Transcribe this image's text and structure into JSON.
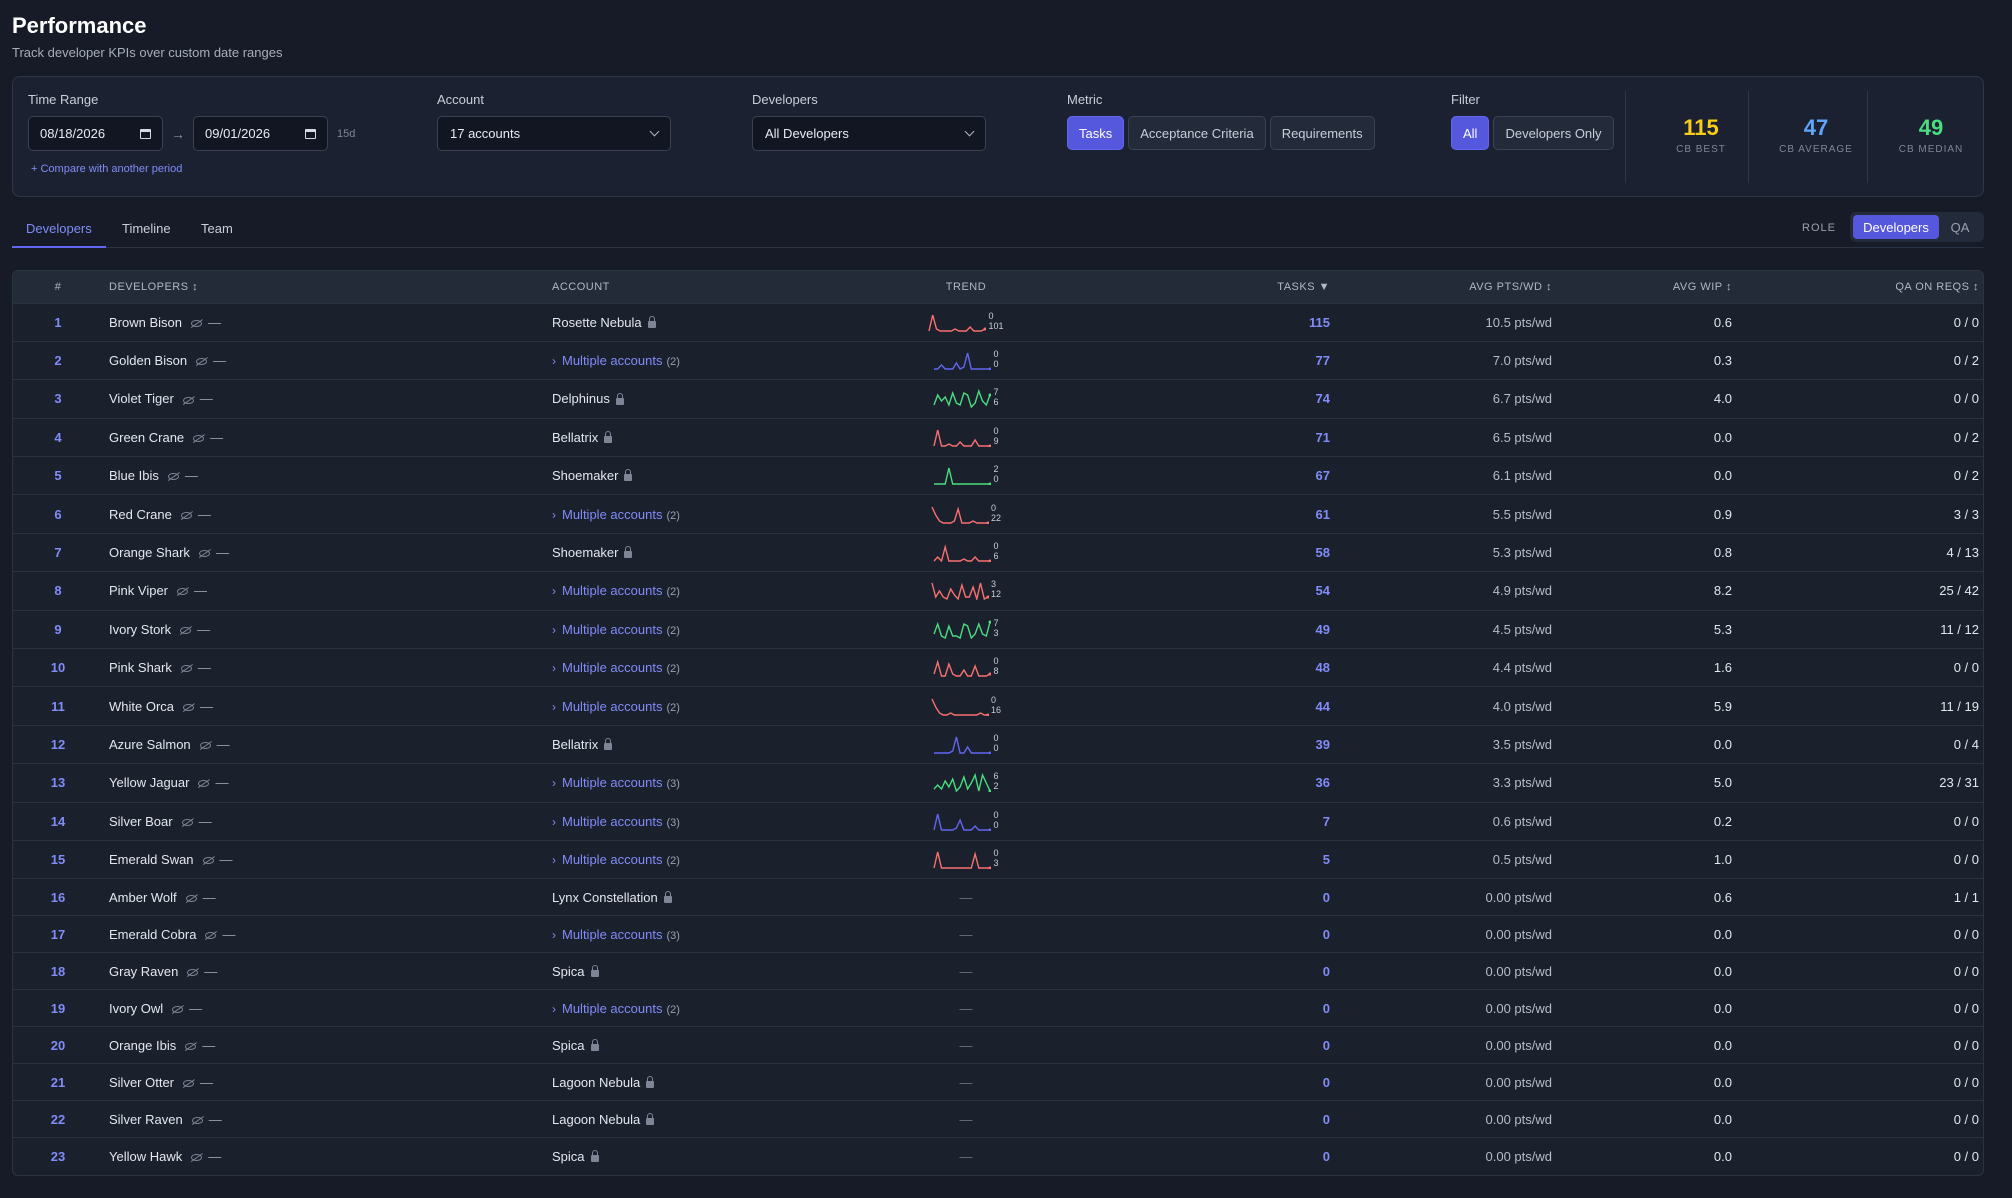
{
  "page": {
    "title": "Performance",
    "subtitle": "Track developer KPIs over custom date ranges"
  },
  "filters": {
    "time_range": {
      "label": "Time Range",
      "start": "08/18/2026",
      "end": "09/01/2026",
      "days": "15d",
      "compare_link": "+ Compare with another period"
    },
    "account": {
      "label": "Account",
      "value": "17 accounts"
    },
    "developers": {
      "label": "Developers",
      "value": "All Developers"
    },
    "metric": {
      "label": "Metric",
      "options": [
        "Tasks",
        "Acceptance Criteria",
        "Requirements"
      ],
      "active": 0
    },
    "filter": {
      "label": "Filter",
      "options": [
        "All",
        "Developers Only"
      ],
      "active": 0
    }
  },
  "kpis": [
    {
      "value": "115",
      "label": "CB BEST",
      "color": "#facc15"
    },
    {
      "value": "47",
      "label": "CB AVERAGE",
      "color": "#60a5fa"
    },
    {
      "value": "49",
      "label": "CB MEDIAN",
      "color": "#4ade80"
    }
  ],
  "tabs": [
    {
      "label": "Developers",
      "active": true
    },
    {
      "label": "Timeline",
      "active": false
    },
    {
      "label": "Team",
      "active": false
    }
  ],
  "role": {
    "label": "ROLE",
    "options": [
      "Developers",
      "QA"
    ],
    "active": 0
  },
  "table": {
    "columns": {
      "rank": "#",
      "developer": "DEVELOPERS ↕",
      "account": "ACCOUNT",
      "trend": "TREND",
      "tasks": "TASKS ▼",
      "avg_pts": "AVG PTS/WD ↕",
      "avg_wip": "AVG WIP ↕",
      "qa": "QA ON REQS ↕"
    },
    "dash": "—",
    "rows": [
      {
        "rank": "1",
        "name": "Brown Bison",
        "account": "Rosette Nebula",
        "multi": false,
        "trend": {
          "color": "#f87171",
          "points": [
            10,
            2,
            9,
            10,
            10,
            10,
            10,
            9,
            10,
            10,
            10,
            8,
            10,
            10,
            10,
            9
          ],
          "top": "0",
          "bottom": "101"
        },
        "tasks": "115",
        "avg_pts": "10.5 pts/wd",
        "avg_wip": "0.6",
        "qa": "0 / 0"
      },
      {
        "rank": "2",
        "name": "Golden Bison",
        "account": "Multiple accounts",
        "multi": true,
        "count": "(2)",
        "trend": {
          "color": "#6366f1",
          "points": [
            10,
            10,
            8,
            10,
            10,
            10,
            7,
            10,
            9,
            2,
            10,
            10,
            10,
            10,
            10,
            10
          ],
          "top": "0",
          "bottom": "0"
        },
        "tasks": "77",
        "avg_pts": "7.0 pts/wd",
        "avg_wip": "0.3",
        "qa": "0 / 2"
      },
      {
        "rank": "3",
        "name": "Violet Tiger",
        "account": "Delphinus",
        "multi": false,
        "trend": {
          "color": "#4ade80",
          "points": [
            9,
            4,
            7,
            5,
            9,
            3,
            8,
            9,
            3,
            4,
            10,
            8,
            2,
            7,
            9,
            4
          ],
          "top": "7",
          "bottom": "6"
        },
        "tasks": "74",
        "avg_pts": "6.7 pts/wd",
        "avg_wip": "4.0",
        "qa": "0 / 0"
      },
      {
        "rank": "4",
        "name": "Green Crane",
        "account": "Bellatrix",
        "multi": false,
        "trend": {
          "color": "#f87171",
          "points": [
            10,
            2,
            10,
            10,
            9,
            10,
            10,
            8,
            10,
            10,
            10,
            7,
            10,
            10,
            10,
            10
          ],
          "top": "0",
          "bottom": "9"
        },
        "tasks": "71",
        "avg_pts": "6.5 pts/wd",
        "avg_wip": "0.0",
        "qa": "0 / 2"
      },
      {
        "rank": "5",
        "name": "Blue Ibis",
        "account": "Shoemaker",
        "multi": false,
        "trend": {
          "color": "#4ade80",
          "points": [
            10,
            10,
            10,
            10,
            2,
            10,
            10,
            10,
            10,
            10,
            10,
            10,
            10,
            10,
            10,
            10
          ],
          "top": "2",
          "bottom": "0"
        },
        "tasks": "67",
        "avg_pts": "6.1 pts/wd",
        "avg_wip": "0.0",
        "qa": "0 / 2"
      },
      {
        "rank": "6",
        "name": "Red Crane",
        "account": "Multiple accounts",
        "multi": true,
        "count": "(2)",
        "trend": {
          "color": "#f87171",
          "points": [
            2,
            6,
            9,
            10,
            10,
            10,
            9,
            3,
            10,
            10,
            10,
            9,
            10,
            10,
            10,
            10
          ],
          "top": "0",
          "bottom": "22"
        },
        "tasks": "61",
        "avg_pts": "5.5 pts/wd",
        "avg_wip": "0.9",
        "qa": "3 / 3"
      },
      {
        "rank": "7",
        "name": "Orange Shark",
        "account": "Shoemaker",
        "multi": false,
        "trend": {
          "color": "#f87171",
          "points": [
            10,
            8,
            10,
            3,
            10,
            10,
            10,
            10,
            9,
            10,
            10,
            8,
            10,
            10,
            10,
            10
          ],
          "top": "0",
          "bottom": "6"
        },
        "tasks": "58",
        "avg_pts": "5.3 pts/wd",
        "avg_wip": "0.8",
        "qa": "4 / 13"
      },
      {
        "rank": "8",
        "name": "Pink Viper",
        "account": "Multiple accounts",
        "multi": true,
        "count": "(2)",
        "trend": {
          "color": "#f87171",
          "points": [
            2,
            9,
            6,
            9,
            10,
            5,
            8,
            10,
            3,
            9,
            9,
            4,
            10,
            2,
            10,
            9
          ],
          "top": "3",
          "bottom": "12"
        },
        "tasks": "54",
        "avg_pts": "4.9 pts/wd",
        "avg_wip": "8.2",
        "qa": "25 / 42"
      },
      {
        "rank": "9",
        "name": "Ivory Stork",
        "account": "Multiple accounts",
        "multi": true,
        "count": "(2)",
        "trend": {
          "color": "#4ade80",
          "points": [
            8,
            3,
            9,
            10,
            4,
            9,
            9,
            10,
            3,
            4,
            10,
            8,
            3,
            8,
            9,
            2
          ],
          "top": "7",
          "bottom": "3"
        },
        "tasks": "49",
        "avg_pts": "4.5 pts/wd",
        "avg_wip": "5.3",
        "qa": "11 / 12"
      },
      {
        "rank": "10",
        "name": "Pink Shark",
        "account": "Multiple accounts",
        "multi": true,
        "count": "(2)",
        "trend": {
          "color": "#f87171",
          "points": [
            9,
            3,
            10,
            10,
            4,
            9,
            10,
            10,
            7,
            10,
            10,
            5,
            10,
            10,
            10,
            9
          ],
          "top": "0",
          "bottom": "8"
        },
        "tasks": "48",
        "avg_pts": "4.4 pts/wd",
        "avg_wip": "1.6",
        "qa": "0 / 0"
      },
      {
        "rank": "11",
        "name": "White Orca",
        "account": "Multiple accounts",
        "multi": true,
        "count": "(2)",
        "trend": {
          "color": "#f87171",
          "points": [
            2,
            6,
            9,
            10,
            10,
            9,
            10,
            10,
            10,
            10,
            10,
            10,
            10,
            9,
            10,
            10
          ],
          "top": "0",
          "bottom": "16"
        },
        "tasks": "44",
        "avg_pts": "4.0 pts/wd",
        "avg_wip": "5.9",
        "qa": "11 / 19"
      },
      {
        "rank": "12",
        "name": "Azure Salmon",
        "account": "Bellatrix",
        "multi": false,
        "trend": {
          "color": "#6366f1",
          "points": [
            10,
            10,
            10,
            10,
            10,
            9,
            2,
            10,
            10,
            7,
            10,
            10,
            10,
            10,
            10,
            10
          ],
          "top": "0",
          "bottom": "0"
        },
        "tasks": "39",
        "avg_pts": "3.5 pts/wd",
        "avg_wip": "0.0",
        "qa": "0 / 4"
      },
      {
        "rank": "13",
        "name": "Yellow Jaguar",
        "account": "Multiple accounts",
        "multi": true,
        "count": "(3)",
        "trend": {
          "color": "#4ade80",
          "points": [
            9,
            7,
            9,
            5,
            8,
            4,
            10,
            8,
            3,
            9,
            6,
            2,
            10,
            2,
            6,
            10
          ],
          "top": "6",
          "bottom": "2"
        },
        "tasks": "36",
        "avg_pts": "3.3 pts/wd",
        "avg_wip": "5.0",
        "qa": "23 / 31"
      },
      {
        "rank": "14",
        "name": "Silver Boar",
        "account": "Multiple accounts",
        "multi": true,
        "count": "(3)",
        "trend": {
          "color": "#6366f1",
          "points": [
            10,
            2,
            10,
            10,
            10,
            10,
            9,
            5,
            10,
            10,
            10,
            8,
            10,
            10,
            10,
            10
          ],
          "top": "0",
          "bottom": "0"
        },
        "tasks": "7",
        "avg_pts": "0.6 pts/wd",
        "avg_wip": "0.2",
        "qa": "0 / 0"
      },
      {
        "rank": "15",
        "name": "Emerald Swan",
        "account": "Multiple accounts",
        "multi": true,
        "count": "(2)",
        "trend": {
          "color": "#f87171",
          "points": [
            10,
            2,
            10,
            10,
            10,
            10,
            10,
            10,
            10,
            10,
            10,
            3,
            10,
            10,
            10,
            10
          ],
          "top": "0",
          "bottom": "3"
        },
        "tasks": "5",
        "avg_pts": "0.5 pts/wd",
        "avg_wip": "1.0",
        "qa": "0 / 0"
      },
      {
        "rank": "16",
        "name": "Amber Wolf",
        "account": "Lynx Constellation",
        "multi": false,
        "trend": null,
        "tasks": "0",
        "avg_pts": "0.00 pts/wd",
        "avg_wip": "0.6",
        "qa": "1 / 1"
      },
      {
        "rank": "17",
        "name": "Emerald Cobra",
        "account": "Multiple accounts",
        "multi": true,
        "count": "(3)",
        "trend": null,
        "tasks": "0",
        "avg_pts": "0.00 pts/wd",
        "avg_wip": "0.0",
        "qa": "0 / 0"
      },
      {
        "rank": "18",
        "name": "Gray Raven",
        "account": "Spica",
        "multi": false,
        "trend": null,
        "tasks": "0",
        "avg_pts": "0.00 pts/wd",
        "avg_wip": "0.0",
        "qa": "0 / 0"
      },
      {
        "rank": "19",
        "name": "Ivory Owl",
        "account": "Multiple accounts",
        "multi": true,
        "count": "(2)",
        "trend": null,
        "tasks": "0",
        "avg_pts": "0.00 pts/wd",
        "avg_wip": "0.0",
        "qa": "0 / 0"
      },
      {
        "rank": "20",
        "name": "Orange Ibis",
        "account": "Spica",
        "multi": false,
        "trend": null,
        "tasks": "0",
        "avg_pts": "0.00 pts/wd",
        "avg_wip": "0.0",
        "qa": "0 / 0"
      },
      {
        "rank": "21",
        "name": "Silver Otter",
        "account": "Lagoon Nebula",
        "multi": false,
        "trend": null,
        "tasks": "0",
        "avg_pts": "0.00 pts/wd",
        "avg_wip": "0.0",
        "qa": "0 / 0"
      },
      {
        "rank": "22",
        "name": "Silver Raven",
        "account": "Lagoon Nebula",
        "multi": false,
        "trend": null,
        "tasks": "0",
        "avg_pts": "0.00 pts/wd",
        "avg_wip": "0.0",
        "qa": "0 / 0"
      },
      {
        "rank": "23",
        "name": "Yellow Hawk",
        "account": "Spica",
        "multi": false,
        "trend": null,
        "tasks": "0",
        "avg_pts": "0.00 pts/wd",
        "avg_wip": "0.0",
        "qa": "0 / 0"
      }
    ]
  }
}
